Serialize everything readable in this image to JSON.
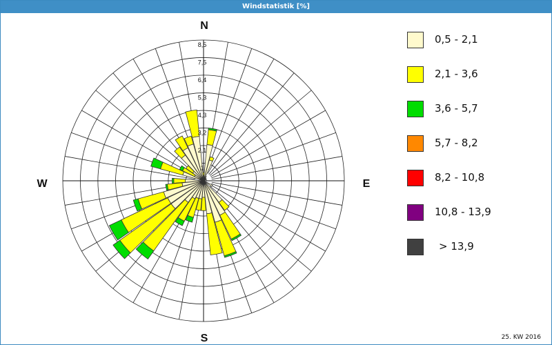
{
  "window": {
    "title": "Windstatistik [%]"
  },
  "footer": {
    "text": "25. KW 2016"
  },
  "compass": {
    "north": "N",
    "east": "E",
    "south": "S",
    "west": "W"
  },
  "legend": [
    {
      "label": "0,5 - 2,1",
      "color": "#fffacd"
    },
    {
      "label": "2,1 - 3,6",
      "color": "#ffff00"
    },
    {
      "label": "3,6 - 5,7",
      "color": "#00dd00"
    },
    {
      "label": "5,7 - 8,2",
      "color": "#ff8800"
    },
    {
      "label": "8,2 - 10,8",
      "color": "#ff0000"
    },
    {
      "label": "10,8 - 13,9",
      "color": "#800080"
    },
    {
      "label": "> 13,9",
      "color": "#404040"
    }
  ],
  "chart_data": {
    "type": "wind-rose",
    "title": "Windstatistik [%]",
    "unit": "%",
    "rmax": 8.5,
    "radial_ticks": [
      "1",
      "2,1",
      "3,2",
      "4,3",
      "5,3",
      "6,4",
      "7,5",
      "8,5"
    ],
    "radial_tick_values": [
      1.06,
      2.13,
      3.19,
      4.25,
      5.31,
      6.38,
      7.44,
      8.5
    ],
    "sector_width_deg": 10,
    "speed_classes": [
      "0,5 - 2,1",
      "2,1 - 3,6",
      "3,6 - 5,7",
      "5,7 - 8,2",
      "8,2 - 10,8",
      "10,8 - 13,9",
      "> 13,9"
    ],
    "sectors": [
      {
        "direction_deg": 0,
        "values": [
          0.3,
          0.2,
          0,
          0,
          0,
          0,
          0
        ]
      },
      {
        "direction_deg": 10,
        "values": [
          2.2,
          0.9,
          0.1,
          0,
          0,
          0,
          0
        ]
      },
      {
        "direction_deg": 20,
        "values": [
          1.3,
          0.2,
          0,
          0,
          0,
          0,
          0
        ]
      },
      {
        "direction_deg": 30,
        "values": [
          0.3,
          0,
          0,
          0,
          0,
          0,
          0
        ]
      },
      {
        "direction_deg": 40,
        "values": [
          0.2,
          0,
          0,
          0,
          0,
          0,
          0
        ]
      },
      {
        "direction_deg": 60,
        "values": [
          0.2,
          0,
          0,
          0,
          0,
          0,
          0
        ]
      },
      {
        "direction_deg": 90,
        "values": [
          0.2,
          0,
          0,
          0,
          0,
          0,
          0
        ]
      },
      {
        "direction_deg": 120,
        "values": [
          0.6,
          0,
          0,
          0,
          0,
          0,
          0
        ]
      },
      {
        "direction_deg": 140,
        "values": [
          1.6,
          0.6,
          0,
          0,
          0,
          0,
          0
        ]
      },
      {
        "direction_deg": 150,
        "values": [
          2.3,
          1.6,
          0.1,
          0,
          0,
          0,
          0
        ]
      },
      {
        "direction_deg": 160,
        "values": [
          2.6,
          2.1,
          0.1,
          0,
          0,
          0,
          0
        ]
      },
      {
        "direction_deg": 170,
        "values": [
          2.0,
          2.5,
          0,
          0,
          0,
          0,
          0
        ]
      },
      {
        "direction_deg": 180,
        "values": [
          1.0,
          0.8,
          0,
          0,
          0,
          0,
          0
        ]
      },
      {
        "direction_deg": 190,
        "values": [
          1.1,
          0.7,
          0,
          0,
          0,
          0,
          0
        ]
      },
      {
        "direction_deg": 200,
        "values": [
          1.1,
          1.2,
          0.3,
          0,
          0,
          0,
          0
        ]
      },
      {
        "direction_deg": 210,
        "values": [
          1.2,
          1.5,
          0.3,
          0,
          0,
          0,
          0
        ]
      },
      {
        "direction_deg": 220,
        "values": [
          1.6,
          3.6,
          0.6,
          0,
          0,
          0,
          0
        ]
      },
      {
        "direction_deg": 230,
        "values": [
          2.4,
          3.8,
          0.5,
          0,
          0,
          0,
          0
        ]
      },
      {
        "direction_deg": 240,
        "values": [
          2.4,
          3.1,
          0.8,
          0,
          0,
          0,
          0
        ]
      },
      {
        "direction_deg": 250,
        "values": [
          2.5,
          1.6,
          0.3,
          0,
          0,
          0,
          0
        ]
      },
      {
        "direction_deg": 260,
        "values": [
          1.3,
          0.9,
          0.1,
          0,
          0,
          0,
          0
        ]
      },
      {
        "direction_deg": 270,
        "values": [
          1.1,
          0.7,
          0.1,
          0,
          0,
          0,
          0
        ]
      },
      {
        "direction_deg": 290,
        "values": [
          1.3,
          1.4,
          0.6,
          0,
          0,
          0,
          0
        ]
      },
      {
        "direction_deg": 300,
        "values": [
          0.6,
          0.8,
          0.2,
          0,
          0,
          0,
          0
        ]
      },
      {
        "direction_deg": 310,
        "values": [
          0.8,
          0.5,
          0,
          0,
          0,
          0,
          0
        ]
      },
      {
        "direction_deg": 320,
        "values": [
          1.9,
          0.6,
          0,
          0,
          0,
          0,
          0
        ]
      },
      {
        "direction_deg": 330,
        "values": [
          2.2,
          0.8,
          0,
          0,
          0,
          0,
          0
        ]
      },
      {
        "direction_deg": 340,
        "values": [
          2.3,
          0.5,
          0,
          0,
          0,
          0,
          0
        ]
      },
      {
        "direction_deg": 350,
        "values": [
          2.7,
          1.6,
          0,
          0,
          0,
          0,
          0
        ]
      }
    ],
    "grid": true
  }
}
